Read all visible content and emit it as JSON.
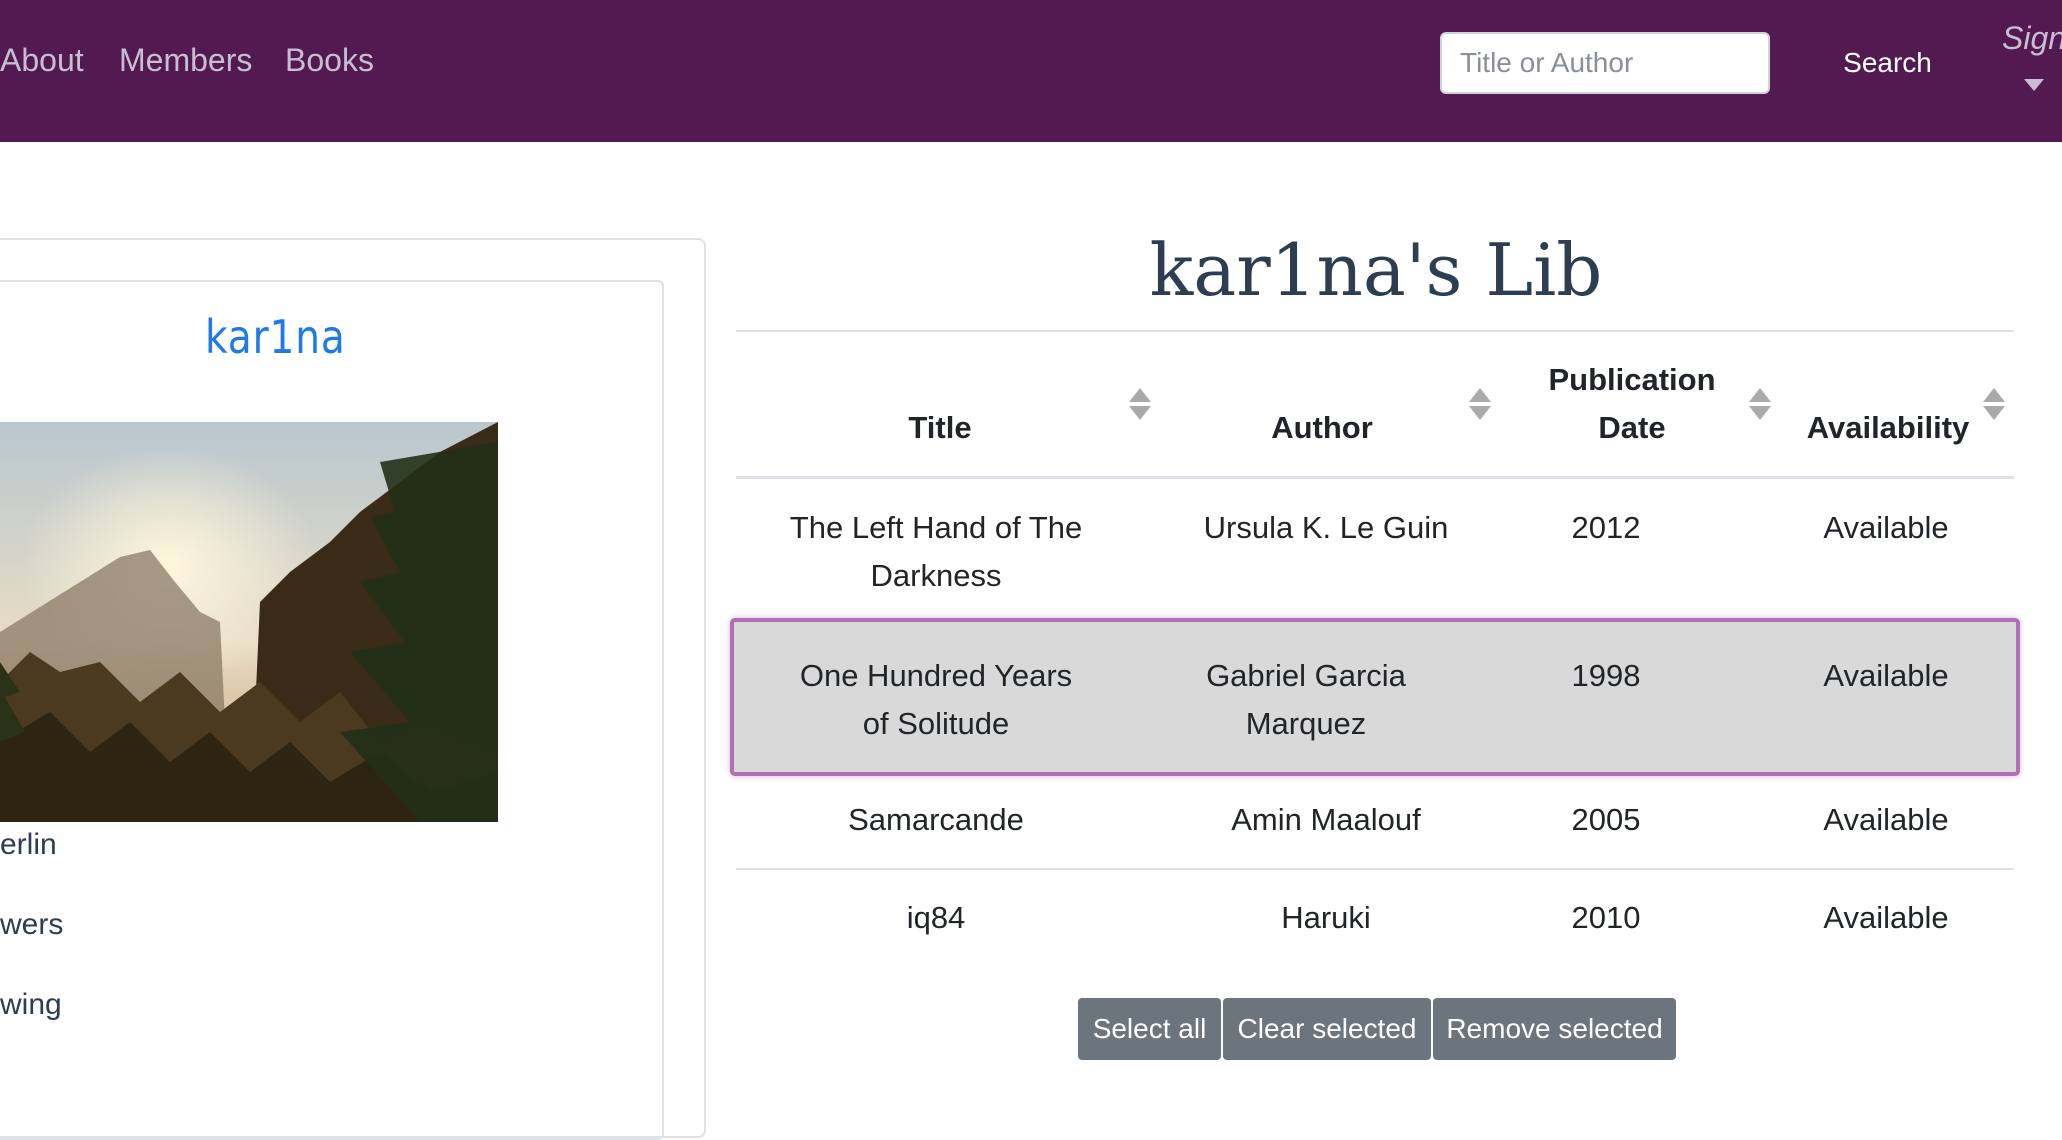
{
  "navbar": {
    "links": [
      "About",
      "Members",
      "Books"
    ],
    "search": {
      "placeholder": "Title or Author",
      "button_label": "Search"
    },
    "signin_label": "Sign"
  },
  "profile": {
    "username": "kar1na",
    "details": [
      "erlin",
      "wers",
      "wing"
    ]
  },
  "library": {
    "title": "kar1na's Lib",
    "columns": [
      "Title",
      "Author",
      "Publication Date",
      "Availability"
    ],
    "rows": [
      {
        "title": "The Left Hand of The Darkness",
        "author": "Ursula K. Le Guin",
        "date": "2012",
        "availability": "Available",
        "selected": false
      },
      {
        "title": "One Hundred Years of Solitude",
        "author": "Gabriel Garcia Marquez",
        "date": "1998",
        "availability": "Available",
        "selected": true
      },
      {
        "title": "Samarcande",
        "author": "Amin Maalouf",
        "date": "2005",
        "availability": "Available",
        "selected": false
      },
      {
        "title": "iq84",
        "author": "Haruki",
        "date": "2010",
        "availability": "Available",
        "selected": false
      }
    ],
    "buttons": {
      "select_all": "Select all",
      "clear_selected": "Clear selected",
      "remove_selected": "Remove selected"
    }
  },
  "colors": {
    "navbar_bg": "#531a51",
    "selected_border": "#b36fb6",
    "username": "#1f7ae8",
    "button_bg": "#6c757d"
  }
}
